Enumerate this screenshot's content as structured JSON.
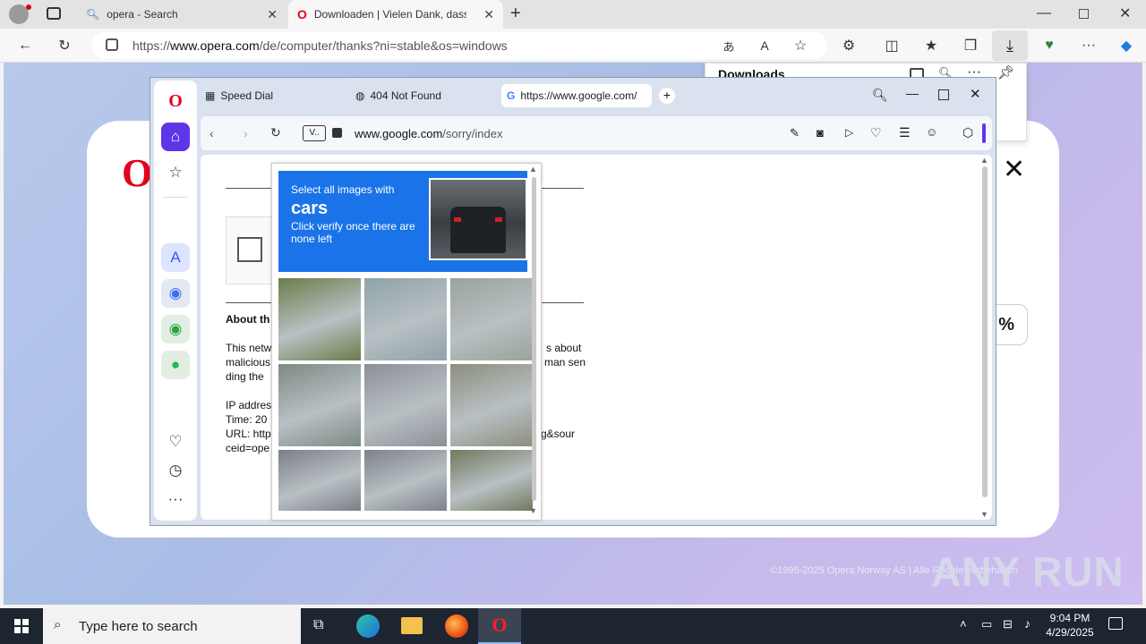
{
  "edge": {
    "tabs": [
      {
        "label": "opera - Search"
      },
      {
        "label": "Downloaden | Vielen Dank, dass "
      }
    ],
    "address_prefix": "https://",
    "address_domain": "www.opera.com",
    "address_path": "/de/computer/thanks?ni=stable&os=windows"
  },
  "downloads": {
    "title": "Downloads"
  },
  "opera_page": {
    "percent": "%",
    "copyright": "©1995-2025 Opera Norway AS | Alle Rechte vorbehalten",
    "watermark": "ANY RUN"
  },
  "opera_browser": {
    "tabs": [
      {
        "label": "Speed Dial"
      },
      {
        "label": "404 Not Found"
      },
      {
        "label": "https://www.google.com/"
      }
    ],
    "vpn_label": "V..",
    "url_domain": "www.google.com",
    "url_path": "/sorry/index"
  },
  "sorry_page": {
    "about_heading": "About th",
    "line1": "This netw",
    "line1_right": "s about",
    "line2": "malicious",
    "line2_right": "man sen",
    "line3": "ding the",
    "ip_label": "IP addres",
    "time_label": "Time: 20",
    "url_label": "URL: http",
    "url_right": "g&sour",
    "url_cont": "ceid=ope"
  },
  "captcha": {
    "instruction": "Select all images with",
    "target": "cars",
    "hint": "Click verify once there are none left",
    "tile_colors": [
      "#6b7d4a",
      "#8ea3a8",
      "#9aa39a",
      "#7d8a85",
      "#8b9096",
      "#8c8f7c",
      "#7a7f86",
      "#7c8288",
      "#6f7a5c"
    ]
  },
  "taskbar": {
    "search_placeholder": "Type here to search",
    "time": "9:04 PM",
    "date": "4/29/2025"
  }
}
